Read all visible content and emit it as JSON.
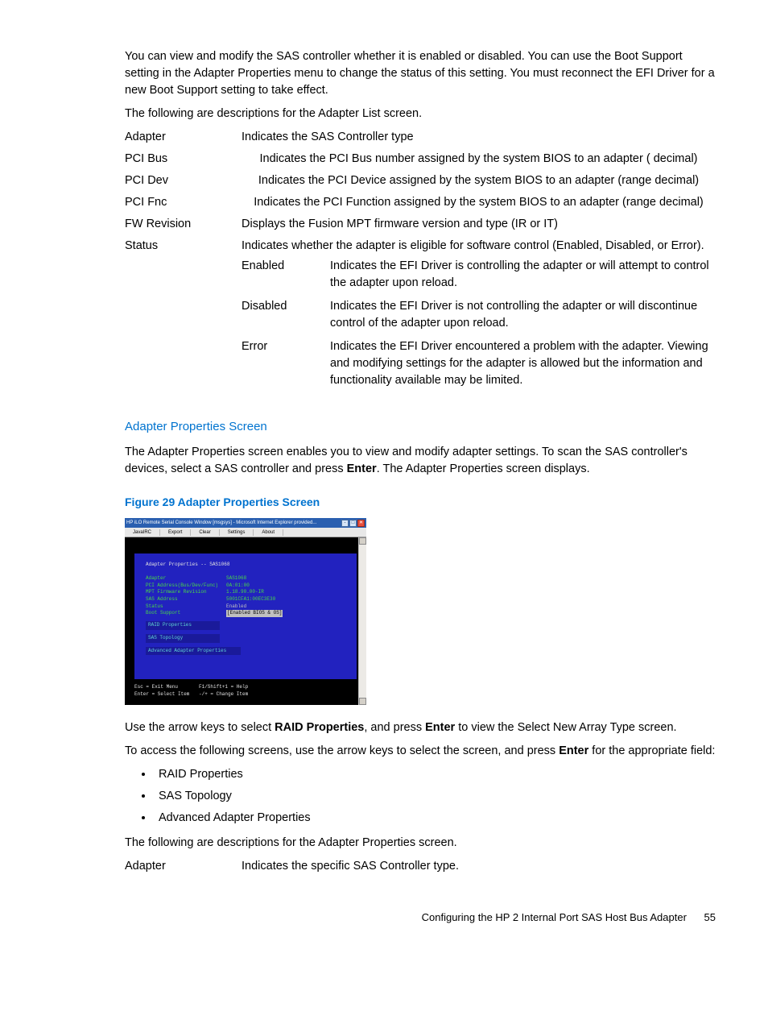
{
  "intro": "You can view and modify the SAS controller whether it is enabled or disabled. You can use the Boot Support setting in the Adapter Properties menu to change the status of this setting. You must reconnect the EFI Driver for a new Boot Support setting to take effect.",
  "intro2": "The following are descriptions for the Adapter List screen.",
  "defs": {
    "adapter": {
      "term": "Adapter",
      "desc": "Indicates the SAS Controller type"
    },
    "pcibus": {
      "term": "PCI Bus",
      "desc": "Indicates the PCI Bus number assigned by the system BIOS to an adapter ( decimal)"
    },
    "pcidev": {
      "term": "PCI Dev",
      "desc": "Indicates the PCI Device assigned by the system BIOS to an adapter (range decimal)"
    },
    "pcifnc": {
      "term": "PCI Fnc",
      "desc": "Indicates the PCI Function assigned by the system BIOS to an adapter (range decimal)"
    },
    "fwrev": {
      "term": "FW Revision",
      "desc": "Displays the Fusion MPT firmware version and type (IR or IT)"
    },
    "status": {
      "term": "Status",
      "desc": "Indicates whether the adapter is eligible for software control (Enabled, Disabled, or Error).",
      "enabled": {
        "term": "Enabled",
        "desc": "Indicates the EFI Driver is controlling the adapter or will attempt to control the adapter upon reload."
      },
      "disabled": {
        "term": "Disabled",
        "desc": "Indicates the EFI Driver is not controlling the adapter or will discontinue control of the adapter upon reload."
      },
      "error": {
        "term": "Error",
        "desc": "Indicates the EFI Driver encountered a problem with the adapter. Viewing and modifying settings for the adapter is allowed but the information and functionality available may be limited."
      }
    }
  },
  "h_adapter_props": "Adapter Properties Screen",
  "adapter_props_p1a": "The Adapter Properties screen enables you to view and modify adapter settings. To scan the SAS controller's devices, select a SAS controller and press ",
  "enter": "Enter",
  "adapter_props_p1b": ". The Adapter Properties screen displays.",
  "fig_caption": "Figure 29 Adapter Properties Screen",
  "fig": {
    "titlebar": "HP iLO Remote Serial Console Window [msgsys] - Microsoft Internet Explorer provided...",
    "tabs": [
      "JavaIRC",
      "Export",
      "Clear",
      "Settings",
      "About"
    ],
    "panel_title": "Adapter Properties -- SAS1068",
    "rows": {
      "adapter": {
        "k": "Adapter",
        "v": "SAS1068"
      },
      "pci": {
        "k": "PCI Address(Bus/Dev/Func)",
        "v": "0A:01:00"
      },
      "fw": {
        "k": "MPT Firmware Revision",
        "v": "1.18.90.00-IR"
      },
      "sas": {
        "k": "SAS Address",
        "v": "5001CFA1:00EC3E30"
      },
      "status": {
        "k": "Status",
        "v": "Enabled"
      },
      "boot": {
        "k": "Boot Support",
        "v": "[Enabled BIOS & OS]"
      }
    },
    "menu": {
      "raid": "RAID Properties",
      "topo": "SAS Topology",
      "adv": "Advanced Adapter Properties"
    },
    "help": {
      "l1a": "Esc = Exit Menu",
      "l1b": "F1/Shift+1 = Help",
      "l2a": "Enter = Select Item",
      "l2b": "-/+ = Change Item"
    }
  },
  "post_fig_p1a": "Use the arrow keys to select ",
  "raid_props": "RAID Properties",
  "post_fig_p1b": ", and press ",
  "post_fig_p1c": " to view the Select New Array Type screen.",
  "post_fig_p2a": "To access the following screens, use the arrow keys to select the screen, and press ",
  "post_fig_p2b": " for the appropriate field:",
  "bullets": {
    "b1": "RAID Properties",
    "b2": "SAS Topology",
    "b3": "Advanced Adapter Properties"
  },
  "post_list": "The following are descriptions for the Adapter Properties screen.",
  "defs2": {
    "adapter": {
      "term": "Adapter",
      "desc": "Indicates the specific SAS Controller type."
    }
  },
  "footer": {
    "text": "Configuring the HP 2 Internal Port SAS Host Bus Adapter",
    "page": "55"
  }
}
